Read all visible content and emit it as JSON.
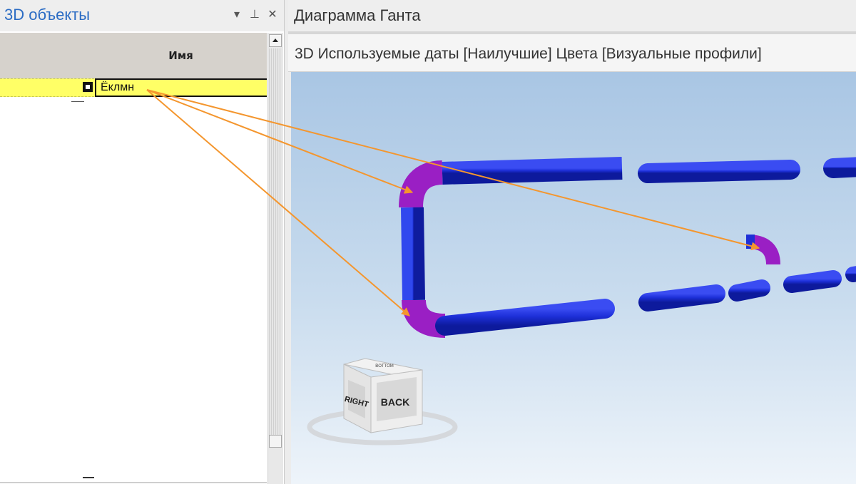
{
  "left_panel": {
    "title": "3D объекты",
    "controls": {
      "dropdown": "▾",
      "pin": "⊥",
      "close": "✕"
    },
    "grid": {
      "column_header": "Имя",
      "rows": [
        {
          "name": "Ёклмн"
        }
      ]
    }
  },
  "document": {
    "tab_title": "Диаграмма Ганта",
    "view_header": "3D Используемые даты [Наилучшие] Цвета [Визуальные профили]"
  },
  "view_cube": {
    "faces": {
      "right": "RIGHT",
      "back": "BACK",
      "top": "BOTTOM"
    }
  },
  "colors": {
    "pipe_blue": "#1f2fd6",
    "bend_purple": "#9a1fc4",
    "arrow_orange": "#f4962e",
    "row_highlight": "#ffff66",
    "title_blue": "#2b6cc4"
  }
}
